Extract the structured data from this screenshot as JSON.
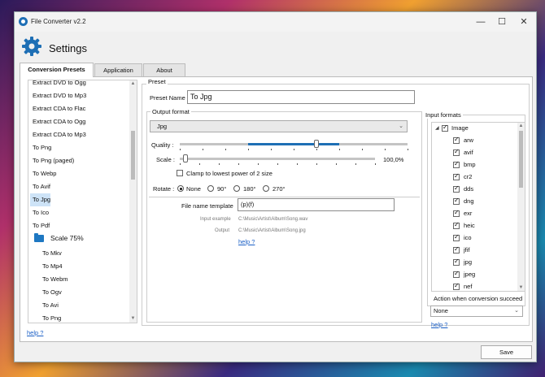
{
  "window": {
    "title": "File Converter v2.2",
    "controls": {
      "minimize": "—",
      "maximize": "☐",
      "close": "✕"
    }
  },
  "header": {
    "title": "Settings"
  },
  "tabs": [
    {
      "label": "Conversion Presets",
      "active": true
    },
    {
      "label": "Application",
      "active": false
    },
    {
      "label": "About",
      "active": false
    }
  ],
  "preset_list": {
    "items": [
      {
        "label": "Extract DVD to Ogg"
      },
      {
        "label": "Extract DVD to Mp3"
      },
      {
        "label": "Extract CDA to Flac"
      },
      {
        "label": "Extract CDA to Ogg"
      },
      {
        "label": "Extract CDA to Mp3"
      },
      {
        "label": "To Png"
      },
      {
        "label": "To Png (paged)"
      },
      {
        "label": "To Webp"
      },
      {
        "label": "To Avif"
      },
      {
        "label": "To Jpg",
        "selected": true
      },
      {
        "label": "To Ico"
      },
      {
        "label": "To Pdf"
      }
    ],
    "folder": {
      "label": "Scale 75%",
      "expander": "◢"
    },
    "folder_items": [
      {
        "label": "To Mkv"
      },
      {
        "label": "To Mp4"
      },
      {
        "label": "To Webm"
      },
      {
        "label": "To Ogv"
      },
      {
        "label": "To Avi"
      },
      {
        "label": "To Png"
      }
    ],
    "help": "help ?"
  },
  "preset": {
    "legend": "Preset",
    "name_label": "Preset Name",
    "name_value": "To Jpg",
    "output_format": {
      "legend": "Output format",
      "format_value": "Jpg",
      "quality_label": "Quality :",
      "quality_fraction": 0.6,
      "scale_label": "Scale :",
      "scale_value": "100,0%",
      "scale_fraction": 0.03,
      "clamp_label": "Clamp to lowest power of 2 size",
      "clamp_checked": false,
      "rotate_label": "Rotate :",
      "rotate_options": [
        {
          "label": "None",
          "selected": true
        },
        {
          "label": "90°",
          "selected": false
        },
        {
          "label": "180°",
          "selected": false
        },
        {
          "label": "270°",
          "selected": false
        }
      ],
      "file_name_template_label": "File name template",
      "file_name_template_value": "(p)(f)",
      "input_example_label": "Input example",
      "input_example_value": "C:\\Music\\Artist\\Album\\Song.wav",
      "output_label": "Output",
      "output_value": "C:\\Music\\Artist\\Album\\Song.jpg",
      "help": "help ?"
    },
    "input_formats": {
      "legend": "Input formats",
      "root": {
        "label": "Image",
        "checked": true,
        "expander": "◢"
      },
      "items": [
        {
          "label": "arw",
          "checked": true
        },
        {
          "label": "avif",
          "checked": true
        },
        {
          "label": "bmp",
          "checked": true
        },
        {
          "label": "cr2",
          "checked": true
        },
        {
          "label": "dds",
          "checked": true
        },
        {
          "label": "dng",
          "checked": true
        },
        {
          "label": "exr",
          "checked": true
        },
        {
          "label": "heic",
          "checked": true
        },
        {
          "label": "ico",
          "checked": true
        },
        {
          "label": "jfif",
          "checked": true
        },
        {
          "label": "jpg",
          "checked": true
        },
        {
          "label": "jpeg",
          "checked": true
        },
        {
          "label": "nef",
          "checked": true
        }
      ],
      "action_label": "Action when conversion succeed",
      "action_value": "None",
      "help": "help ?"
    }
  },
  "footer": {
    "save_label": "Save"
  },
  "colors": {
    "accent": "#1e6fb5",
    "link": "#1a5fc6",
    "selection": "#cde3f7"
  }
}
